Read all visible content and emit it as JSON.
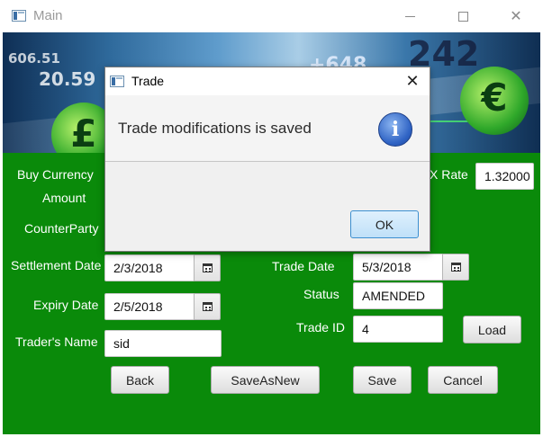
{
  "window": {
    "title": "Main",
    "minimize_label": "",
    "maximize_label": "",
    "close_glyph": "✕"
  },
  "banner": {
    "numbers": [
      "606.51",
      "20.59",
      "+648",
      "242"
    ],
    "coin_left_symbol": "£",
    "coin_right_symbol": "€"
  },
  "form": {
    "buy_currency_label": "Buy Currency",
    "amount_label": "Amount",
    "counterparty_label": "CounterParty",
    "fx_rate_label": "X Rate",
    "fx_rate_value": "1.32000",
    "settlement_date_label": "Settlement Date",
    "settlement_date_value": "2/3/2018",
    "expiry_date_label": "Expiry Date",
    "expiry_date_value": "2/5/2018",
    "trader_name_label": "Trader's Name",
    "trader_name_value": "sid",
    "trade_date_label": "Trade Date",
    "trade_date_value": "5/3/2018",
    "status_label": "Status",
    "status_value": "AMENDED",
    "trade_id_label": "Trade ID",
    "trade_id_value": "4"
  },
  "buttons": {
    "load": "Load",
    "back": "Back",
    "save_as_new": "SaveAsNew",
    "save": "Save",
    "cancel": "Cancel"
  },
  "dialog": {
    "title": "Trade",
    "close_glyph": "✕",
    "message": "Trade modifications is saved",
    "info_glyph": "i",
    "ok": "OK"
  },
  "icons": {
    "app": "window-app-icon",
    "calendar": "calendar-icon",
    "info": "information-icon"
  },
  "colors": {
    "background_green": "#0a8a0a",
    "dialog_ok_border": "#3c8fd0",
    "info_blue": "#2f63c4"
  }
}
